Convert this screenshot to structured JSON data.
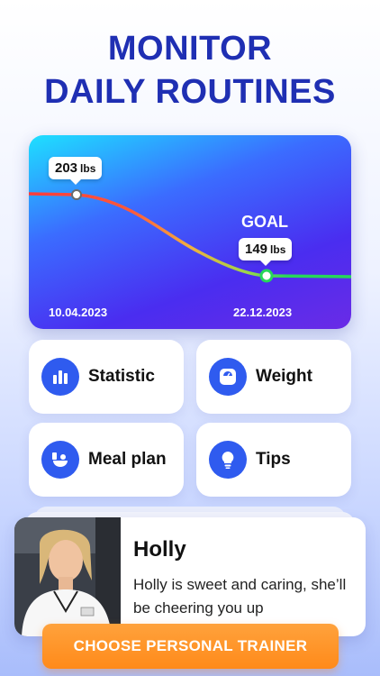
{
  "headline": {
    "line1": "MONITOR",
    "line2": "DAILY ROUTINES"
  },
  "progress_chart": {
    "start_weight": "203",
    "start_unit": "lbs",
    "goal_label": "GOAL",
    "goal_weight": "149",
    "goal_unit": "lbs",
    "start_date": "10.04.2023",
    "goal_date": "22.12.2023",
    "colors": {
      "start_line": "#ff3b3b",
      "end_line": "#27d65a"
    }
  },
  "menu": {
    "statistic": {
      "label": "Statistic",
      "icon": "bar-chart-icon"
    },
    "weight": {
      "label": "Weight",
      "icon": "scale-icon"
    },
    "meal_plan": {
      "label": "Meal plan",
      "icon": "meal-icon"
    },
    "tips": {
      "label": "Tips",
      "icon": "lightbulb-icon"
    }
  },
  "trainer": {
    "name": "Holly",
    "description": "Holly is sweet and caring, she’ll be cheering you up"
  },
  "cta": {
    "label": "CHOOSE PERSONAL TRAINER",
    "color": "#ff8a1a"
  },
  "accent": "#2f5bef"
}
